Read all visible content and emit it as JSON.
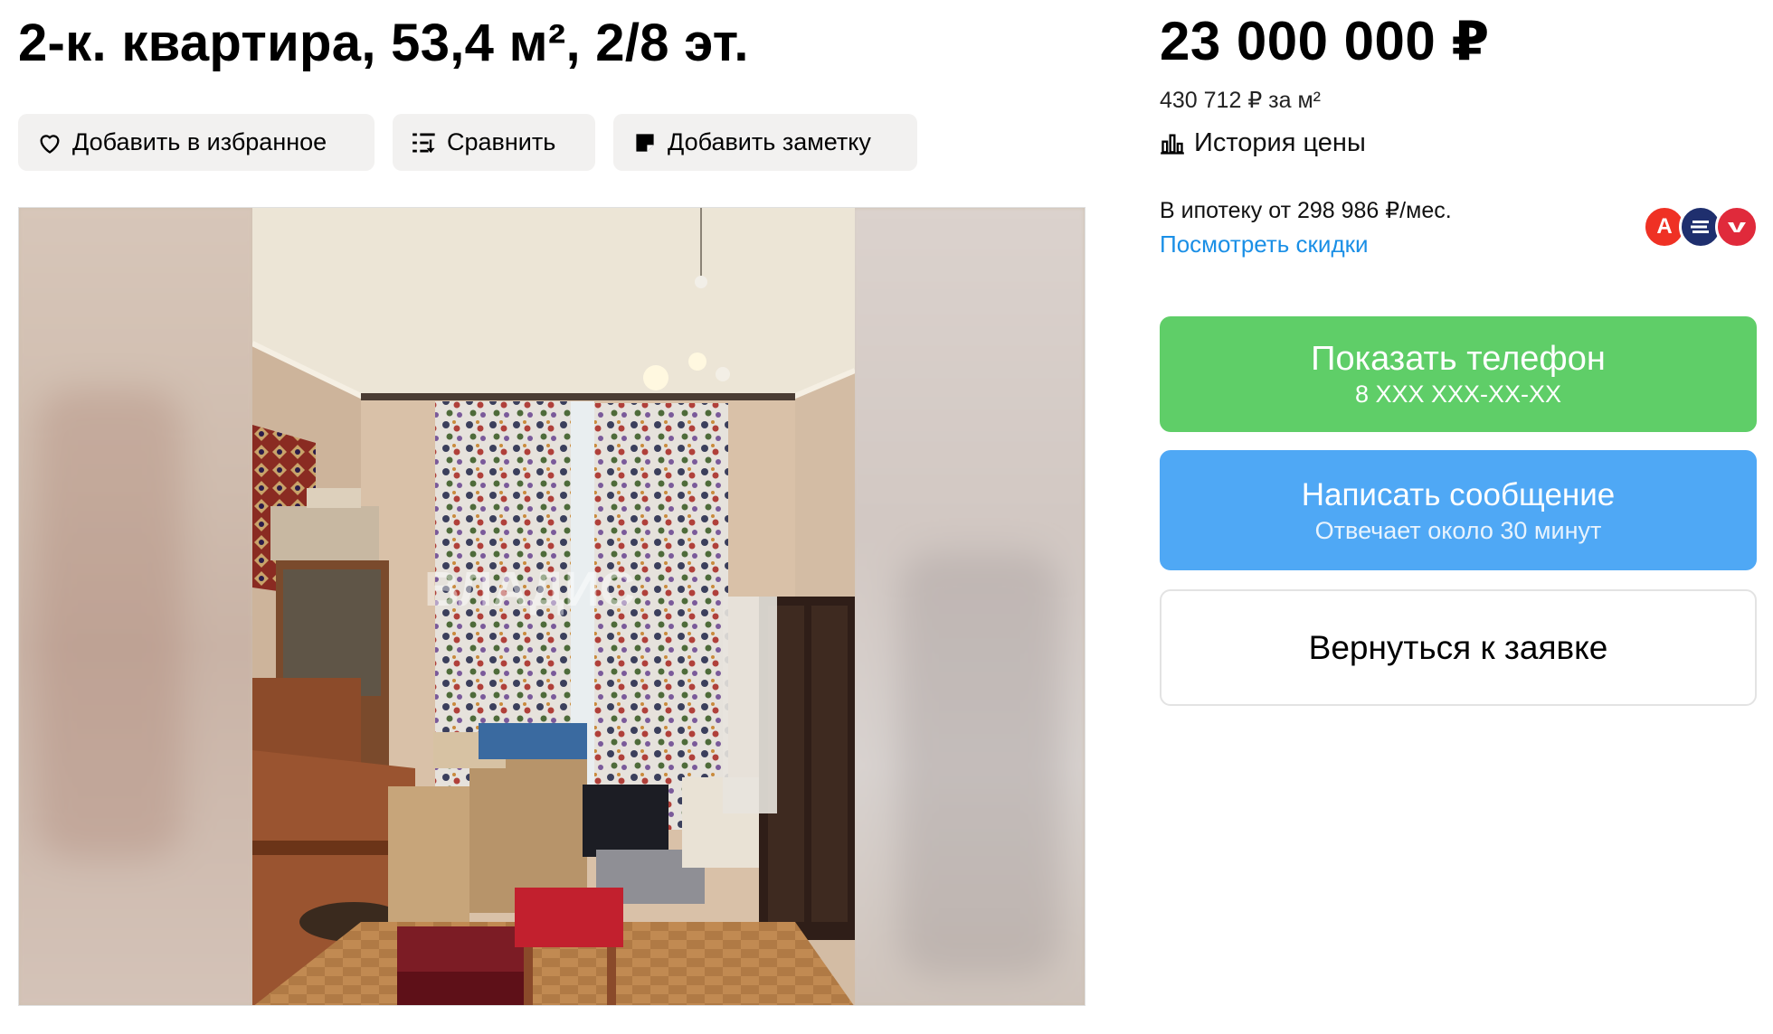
{
  "listing": {
    "title": "2-к. квартира, 53,4 м², 2/8 эт."
  },
  "actions": {
    "favorite_label": "Добавить в избранное",
    "compare_label": "Сравнить",
    "note_label": "Добавить заметку"
  },
  "photo": {
    "watermark": "ВЛАДИС"
  },
  "pricing": {
    "price": "23 000 000 ₽",
    "per_m2": "430 712 ₽ за м²",
    "history_label": "История цены"
  },
  "mortgage": {
    "text": "В ипотеку от 298 986 ₽/мес.",
    "link": "Посмотреть скидки",
    "banks": [
      {
        "icon": "bank-a-icon",
        "letter": "А",
        "color": "#ef3124"
      },
      {
        "icon": "bank-b-icon",
        "letter": "",
        "color": "#1f2f6e"
      },
      {
        "icon": "bank-c-icon",
        "letter": "",
        "color": "#e02a3b"
      }
    ]
  },
  "contacts": {
    "phone_label": "Показать телефон",
    "phone_mask": "8 XXX XXX-XX-XX",
    "message_label": "Написать сообщение",
    "message_sub": "Отвечает около 30 минут",
    "back_label": "Вернуться к заявке"
  },
  "colors": {
    "phone_button": "#5fce68",
    "message_button": "#4fa8f5",
    "link": "#1a8fe6",
    "secondary_button_bg": "#f2f1f0"
  }
}
